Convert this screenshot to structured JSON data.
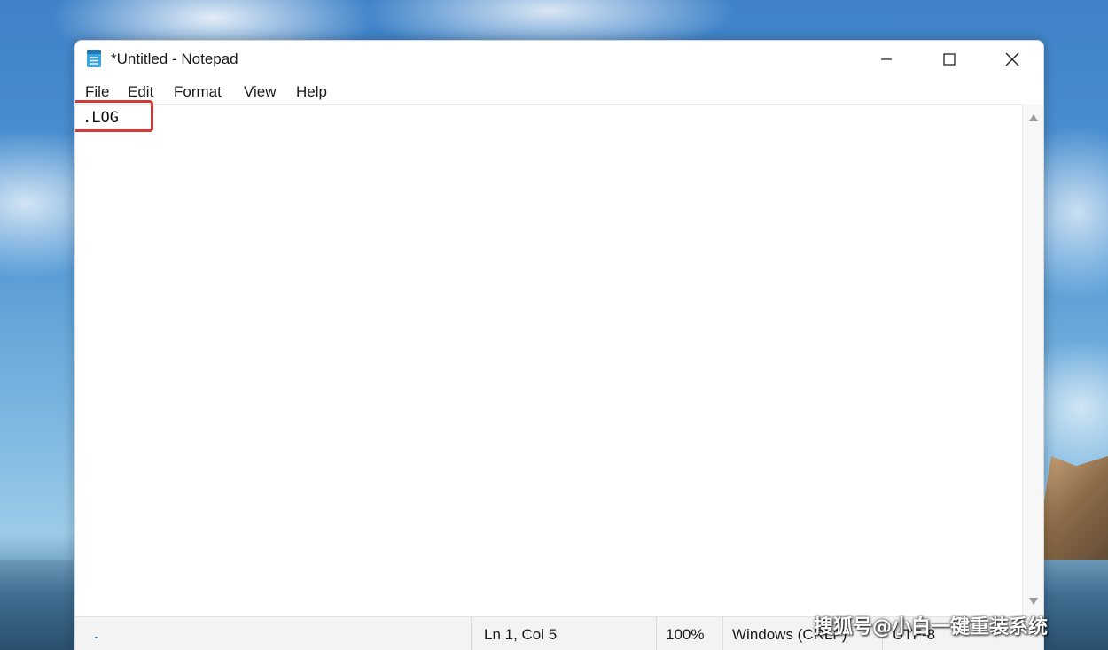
{
  "window": {
    "title": "*Untitled - Notepad",
    "icon": "notepad-icon"
  },
  "controls": {
    "minimize_icon": "minimize-icon",
    "maximize_icon": "maximize-icon",
    "close_icon": "close-icon"
  },
  "menu": {
    "items": [
      "File",
      "Edit",
      "Format",
      "View",
      "Help"
    ]
  },
  "editor": {
    "content": ".LOG",
    "highlight_color": "#d33a3a"
  },
  "statusbar": {
    "position": "Ln 1, Col 5",
    "zoom": "100%",
    "line_ending": "Windows (CRLF)",
    "encoding": "UTF-8"
  },
  "watermark": {
    "text": "搜狐号@小白一键重装系统"
  }
}
